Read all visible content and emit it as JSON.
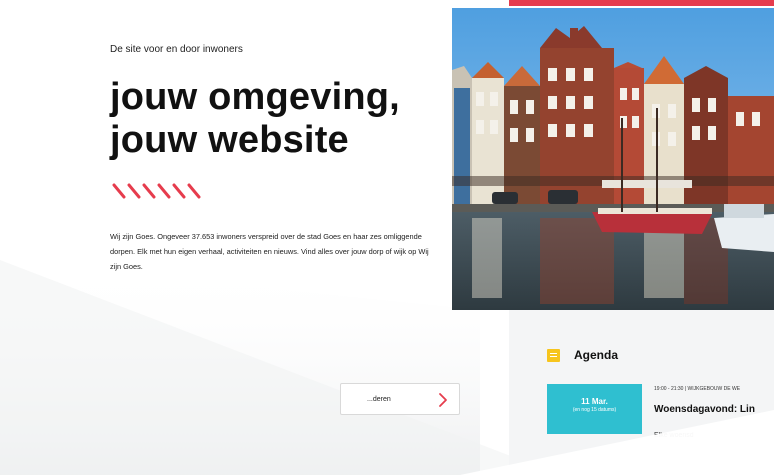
{
  "hero": {
    "tagline": "De site voor en door inwoners",
    "headline_line1": "jouw omgeving,",
    "headline_line2": "jouw website",
    "intro": "Wij zijn Goes. Ongeveer 37.653 inwoners verspreid over de stad Goes en haar zes omliggende dorpen. Elk met hun eigen verhaal, activiteiten en nieuws. Vind alles over jouw dorp of wijk op Wij zijn Goes.",
    "accent_color": "#e63c4d"
  },
  "more_link": {
    "label": "Veranderen",
    "visible_label": "...deren",
    "icon": "chevron-right-icon"
  },
  "agenda": {
    "title": "Agenda",
    "icon": "calendar-icon",
    "event": {
      "date": "11 Mar.",
      "date_sub": "(en nog 15 datums)",
      "meta": "19:00 - 21:30 | WIJKGEBOUW DE WE",
      "title": "Woensdagavond: Lin",
      "description": "Elke woensd"
    },
    "date_color": "#2fbfd0",
    "icon_color": "#f7c51d"
  }
}
